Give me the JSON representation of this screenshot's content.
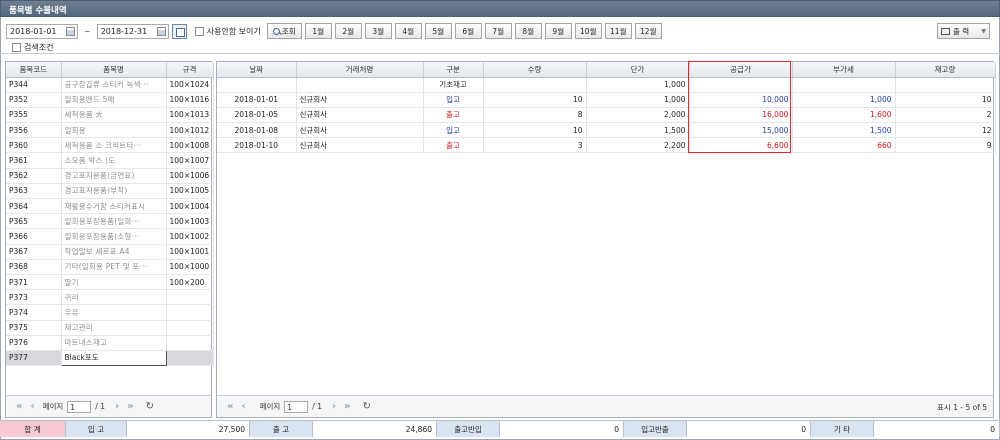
{
  "title": "품목별 수불내역",
  "toolbar": {
    "date_from": "2018-01-01",
    "tilde": "~",
    "date_to": "2018-12-31",
    "show_unused_label": "사용안함 보이기",
    "search_label": "조회",
    "months": [
      "1월",
      "2월",
      "3월",
      "4월",
      "5월",
      "6월",
      "7월",
      "8월",
      "9월",
      "10월",
      "11월",
      "12월"
    ],
    "print_label": "출 력"
  },
  "search_condition_label": "검색조건",
  "left_grid": {
    "headers": [
      "품목코드",
      "품목명",
      "규격"
    ],
    "rows": [
      {
        "code": "P344",
        "name": "공구장갑류 스티커 녹색···",
        "spec": "100×1024"
      },
      {
        "code": "P352",
        "name": "일회용밴드 5매",
        "spec": "100×1016"
      },
      {
        "code": "P355",
        "name": "세척용품 大",
        "spec": "100×1013"
      },
      {
        "code": "P356",
        "name": "일회용",
        "spec": "100×1012"
      },
      {
        "code": "P360",
        "name": "세척용품 소 크리트타···",
        "spec": "100×1008"
      },
      {
        "code": "P361",
        "name": "소모품 박스 (도",
        "spec": "100×1007"
      },
      {
        "code": "P362",
        "name": "경고표지용품(금연표)",
        "spec": "100×1006"
      },
      {
        "code": "P363",
        "name": "경고표지용품(부착)",
        "spec": "100×1005"
      },
      {
        "code": "P364",
        "name": "재활용수거함 스티커표시",
        "spec": "100×1004"
      },
      {
        "code": "P365",
        "name": "일회용포장용품(일회···",
        "spec": "100×1003"
      },
      {
        "code": "P366",
        "name": "일회용포장용품(소형···",
        "spec": "100×1002"
      },
      {
        "code": "P367",
        "name": "작업일보 세로표 A4",
        "spec": "100×1001"
      },
      {
        "code": "P368",
        "name": "기타(일회용 PET 및 포···",
        "spec": "100×1000"
      },
      {
        "code": "P371",
        "name": "딸기",
        "spec": "100×200"
      },
      {
        "code": "P373",
        "name": "귀리",
        "spec": ""
      },
      {
        "code": "P374",
        "name": "우유",
        "spec": ""
      },
      {
        "code": "P375",
        "name": "재고관리",
        "spec": ""
      },
      {
        "code": "P376",
        "name": "마트내스재고",
        "spec": ""
      },
      {
        "code": "P377",
        "name": "Black포도",
        "spec": ""
      }
    ],
    "pager": {
      "page_label": "페이지",
      "page": "1",
      "of": "/ 1"
    }
  },
  "right_grid": {
    "headers": [
      "날짜",
      "거래처명",
      "구분",
      "수량",
      "단가",
      "공급가",
      "부가세",
      "재고량"
    ],
    "rows": [
      {
        "date": "",
        "vendor": "",
        "type": "기초재고",
        "qty": "",
        "price": "1,000",
        "supply": "",
        "vat": "",
        "stock": ""
      },
      {
        "date": "2018-01-01",
        "vendor": "신규회사",
        "type": "입고",
        "qty": "10",
        "price": "1,000",
        "supply": "10,000",
        "vat": "1,000",
        "stock": "10"
      },
      {
        "date": "2018-01-05",
        "vendor": "신규회사",
        "type": "출고",
        "qty": "8",
        "price": "2,000",
        "supply": "16,000",
        "vat": "1,600",
        "stock": "2"
      },
      {
        "date": "2018-01-08",
        "vendor": "신규회사",
        "type": "입고",
        "qty": "10",
        "price": "1,500",
        "supply": "15,000",
        "vat": "1,500",
        "stock": "12"
      },
      {
        "date": "2018-01-10",
        "vendor": "신규회사",
        "type": "출고",
        "qty": "3",
        "price": "2,200",
        "supply": "6,600",
        "vat": "660",
        "stock": "9"
      }
    ],
    "pager": {
      "page_label": "페이지",
      "page": "1",
      "of": "/ 1",
      "summary": "표시 1 - 5 of 5"
    }
  },
  "footer": {
    "total_label": "합 계",
    "in_label": "입 고",
    "in_value": "27,500",
    "out_label": "출 고",
    "out_value": "24,860",
    "out_return_label": "출고반입",
    "out_return_value": "0",
    "in_return_label": "입고반출",
    "in_return_value": "0",
    "etc_label": "기 타",
    "etc_value": "0"
  },
  "colors": {
    "inbound": "#1f3aa8",
    "outbound": "#d2141c",
    "highlight": "#e8262b"
  }
}
